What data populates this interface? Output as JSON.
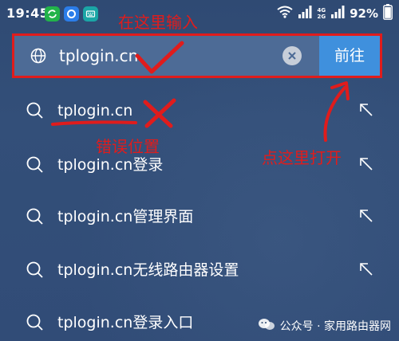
{
  "status_bar": {
    "time": "19:45",
    "net_top": "4G",
    "net_bottom": "2G",
    "battery": "92%"
  },
  "search": {
    "value": "tplogin.cn",
    "go_label": "前往"
  },
  "suggestions": [
    {
      "text": "tplogin.cn"
    },
    {
      "text": "tplogin.cn登录"
    },
    {
      "text": "tplogin.cn管理界面"
    },
    {
      "text": "tplogin.cn无线路由器设置"
    },
    {
      "text": "tplogin.cn登录入口"
    }
  ],
  "annotations": {
    "enter_here": "在这里输入",
    "wrong_position": "错误位置",
    "click_here_to_open": "点这里打开",
    "annotation_color": "#e01c1c"
  },
  "watermark": {
    "text": "公众号 · 家用路由器网"
  },
  "colors": {
    "go_button": "#3f90dd",
    "search_bar": "#4d6b96",
    "background": "#2f4a73"
  },
  "icons": [
    "wechat-icon",
    "app-icon",
    "keyboard-icon",
    "wifi-icon",
    "signal-icon",
    "battery-icon",
    "globe-icon",
    "clear-icon",
    "search-icon",
    "fill-arrow-icon"
  ]
}
